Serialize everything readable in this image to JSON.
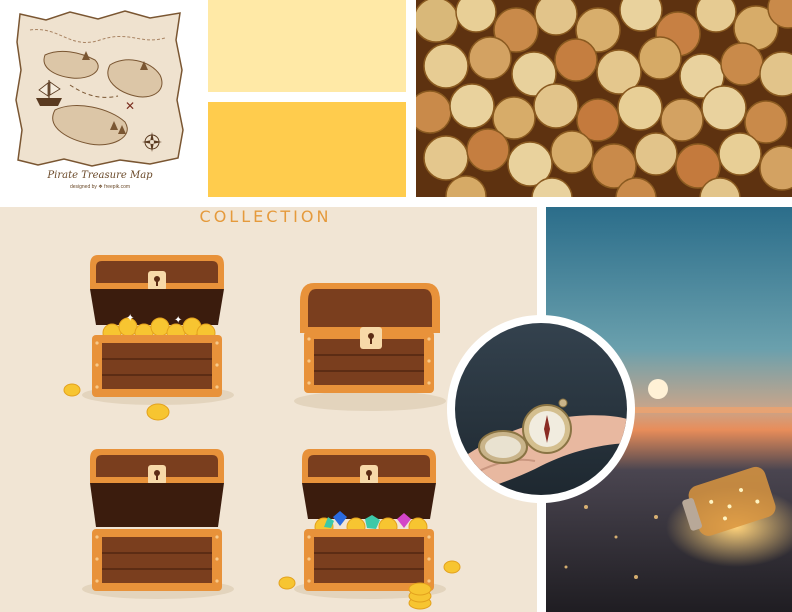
{
  "map": {
    "caption": "Pirate Treasure Map",
    "credit": "designed by ❖ freepik.com"
  },
  "palette": {
    "light_yellow": "#ffe9a6",
    "gold_yellow": "#ffcc4d",
    "chest_background": "#f1e5d4",
    "accent_orange": "#e59a3c"
  },
  "collection": {
    "title": "COLLECTION"
  }
}
